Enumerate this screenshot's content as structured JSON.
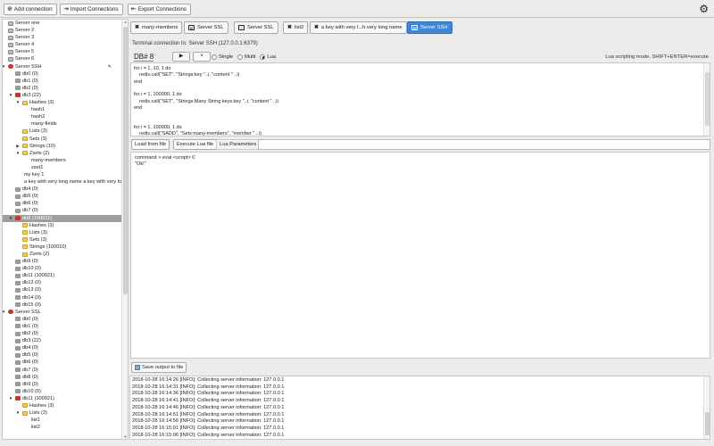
{
  "toolbar": {
    "add_connection": "Add connection",
    "import_connections": "Import Connections",
    "export_connections": "Export Connections"
  },
  "tree": [
    {
      "label": "Server one",
      "type": "server",
      "depth": 0
    },
    {
      "label": "Server 2",
      "type": "server",
      "depth": 0
    },
    {
      "label": "Server 3",
      "type": "server",
      "depth": 0
    },
    {
      "label": "Server 4",
      "type": "server",
      "depth": 0
    },
    {
      "label": "Server 5",
      "type": "server",
      "depth": 0
    },
    {
      "label": "Server 6",
      "type": "server",
      "depth": 0
    },
    {
      "label": "Server SSH",
      "type": "server-open",
      "depth": 0,
      "expanded": true,
      "pinned": true
    },
    {
      "label": "db0 (0)",
      "type": "db",
      "depth": 1
    },
    {
      "label": "db1 (0)",
      "type": "db",
      "depth": 1
    },
    {
      "label": "db2 (0)",
      "type": "db",
      "depth": 1
    },
    {
      "label": "db3 (22)",
      "type": "db-open",
      "depth": 1,
      "expanded": true
    },
    {
      "label": "Hashes (3)",
      "type": "folder",
      "depth": 2,
      "expanded": true
    },
    {
      "label": "hash1",
      "type": "key",
      "depth": 3
    },
    {
      "label": "hash2",
      "type": "key",
      "depth": 3
    },
    {
      "label": "many-fields",
      "type": "key",
      "depth": 3
    },
    {
      "label": "Lists (3)",
      "type": "folder",
      "depth": 2
    },
    {
      "label": "Sets (3)",
      "type": "folder",
      "depth": 2
    },
    {
      "label": "Strings (10)",
      "type": "folder",
      "depth": 2,
      "collapsed": true
    },
    {
      "label": "Zsets (2)",
      "type": "folder",
      "depth": 2,
      "expanded": true
    },
    {
      "label": "many-members",
      "type": "key",
      "depth": 3
    },
    {
      "label": "zset1",
      "type": "key",
      "depth": 3
    },
    {
      "label": "my key 1",
      "type": "key",
      "depth": 2
    },
    {
      "label": "a key with very long name a key with very long name",
      "type": "key",
      "depth": 2
    },
    {
      "label": "db4 (0)",
      "type": "db",
      "depth": 1
    },
    {
      "label": "db5 (0)",
      "type": "db",
      "depth": 1
    },
    {
      "label": "db6 (0)",
      "type": "db",
      "depth": 1
    },
    {
      "label": "db7 (0)",
      "type": "db",
      "depth": 1
    },
    {
      "label": "db8 (100021)",
      "type": "db-open",
      "depth": 1,
      "expanded": true,
      "selected": true
    },
    {
      "label": "Hashes (3)",
      "type": "folder",
      "depth": 2
    },
    {
      "label": "Lists (3)",
      "type": "folder",
      "depth": 2
    },
    {
      "label": "Sets (3)",
      "type": "folder",
      "depth": 2
    },
    {
      "label": "Strings (100010)",
      "type": "folder",
      "depth": 2
    },
    {
      "label": "Zsets (2)",
      "type": "folder",
      "depth": 2
    },
    {
      "label": "db9 (0)",
      "type": "db",
      "depth": 1
    },
    {
      "label": "db10 (0)",
      "type": "db",
      "depth": 1
    },
    {
      "label": "db11 (100021)",
      "type": "db",
      "depth": 1
    },
    {
      "label": "db12 (0)",
      "type": "db",
      "depth": 1
    },
    {
      "label": "db13 (0)",
      "type": "db",
      "depth": 1
    },
    {
      "label": "db14 (0)",
      "type": "db",
      "depth": 1
    },
    {
      "label": "db15 (0)",
      "type": "db",
      "depth": 1
    },
    {
      "label": "Server SSL",
      "type": "server-open",
      "depth": 0,
      "expanded": true
    },
    {
      "label": "db0 (0)",
      "type": "db",
      "depth": 1
    },
    {
      "label": "db1 (0)",
      "type": "db",
      "depth": 1
    },
    {
      "label": "db2 (0)",
      "type": "db",
      "depth": 1
    },
    {
      "label": "db3 (22)",
      "type": "db",
      "depth": 1
    },
    {
      "label": "db4 (0)",
      "type": "db",
      "depth": 1
    },
    {
      "label": "db5 (0)",
      "type": "db",
      "depth": 1
    },
    {
      "label": "db6 (0)",
      "type": "db",
      "depth": 1
    },
    {
      "label": "db7 (0)",
      "type": "db",
      "depth": 1
    },
    {
      "label": "db8 (0)",
      "type": "db",
      "depth": 1
    },
    {
      "label": "db9 (0)",
      "type": "db",
      "depth": 1
    },
    {
      "label": "db10 (0)",
      "type": "db",
      "depth": 1
    },
    {
      "label": "db11 (100021)",
      "type": "db-open",
      "depth": 1,
      "expanded": true
    },
    {
      "label": "Hashes (3)",
      "type": "folder",
      "depth": 2
    },
    {
      "label": "Lists (3)",
      "type": "folder",
      "depth": 2,
      "expanded": true
    },
    {
      "label": "list1",
      "type": "key",
      "depth": 3
    },
    {
      "label": "list2",
      "type": "key",
      "depth": 3
    }
  ],
  "tabs": [
    {
      "label": "many-members",
      "icon": "close-icon",
      "icon_char": "✖"
    },
    {
      "label": "Server SSL",
      "icon": "console-icon",
      "icon_char": "▤"
    },
    {
      "label": "Server SSL",
      "icon": "info-icon",
      "icon_char": "ⓘ"
    },
    {
      "label": "list2",
      "icon": "close-icon",
      "icon_char": "✖"
    },
    {
      "label": "a key with very l...h very long name",
      "icon": "close-icon",
      "icon_char": "✖"
    },
    {
      "label": "Server SSH",
      "icon": "console-icon",
      "icon_char": "▤",
      "active": true
    }
  ],
  "terminal": {
    "title": "Terminal connection to: Server SSH (127.0.0.1:6379)",
    "db_label": "DB# 8",
    "run_label": "▶",
    "clear_label": "×",
    "modes": [
      {
        "label": "Single",
        "selected": false
      },
      {
        "label": "Multi",
        "selected": false
      },
      {
        "label": "Lua",
        "selected": true
      }
    ],
    "mode_hint": "Lua scripting mode, SHIFT+ENTER=execute"
  },
  "editor": {
    "lines": [
      "for i = 1, 10, 1 do",
      "    redis.call(\"SET\", \"Strings:key \"..i, \"content \" ..i)",
      "end",
      "",
      "for i = 1, 100000, 1 do",
      "    redis.call(\"SET\", \"Strings:Many String keys:key \"..i, \"content \" ..i)",
      "end",
      "",
      "",
      "for i = 1, 100000, 1 do",
      "    redis.call(\"SADD\", \"Sets:many-members\", \"member \" ..i)"
    ]
  },
  "lua_toolbar": {
    "load_file": "Load from file",
    "execute_file": "Execute Lua file",
    "params_label": "Lua Parameters",
    "params_value": ""
  },
  "output": {
    "lines": [
      "command > eval <script> 0",
      "\"Ok!\""
    ],
    "save_label": "Save output to file"
  },
  "log": {
    "lines": [
      "2018-10-28 16:14:26 [INFO]: Collecting server information: 127.0.0.1",
      "2018-10-28 16:14:31 [INFO]: Collecting server information: 127.0.0.1",
      "2018-10-28 16:14:36 [INFO]: Collecting server information: 127.0.0.1",
      "2018-10-28 16:14:41 [INFO]: Collecting server information: 127.0.0.1",
      "2018-10-28 16:14:46 [INFO]: Collecting server information: 127.0.0.1",
      "2018-10-28 16:14:51 [INFO]: Collecting server information: 127.0.0.1",
      "2018-10-28 16:14:56 [INFO]: Collecting server information: 127.0.0.1",
      "2018-10-28 16:15:01 [INFO]: Collecting server information: 127.0.0.1",
      "2018-10-28 16:15:06 [INFO]: Collecting server information: 127.0.0.1"
    ]
  },
  "colors": {
    "accent": "#3f86d6",
    "server_active": "#c0392b",
    "folder": "#f2c94c",
    "selected_row": "#9e9e9e"
  }
}
